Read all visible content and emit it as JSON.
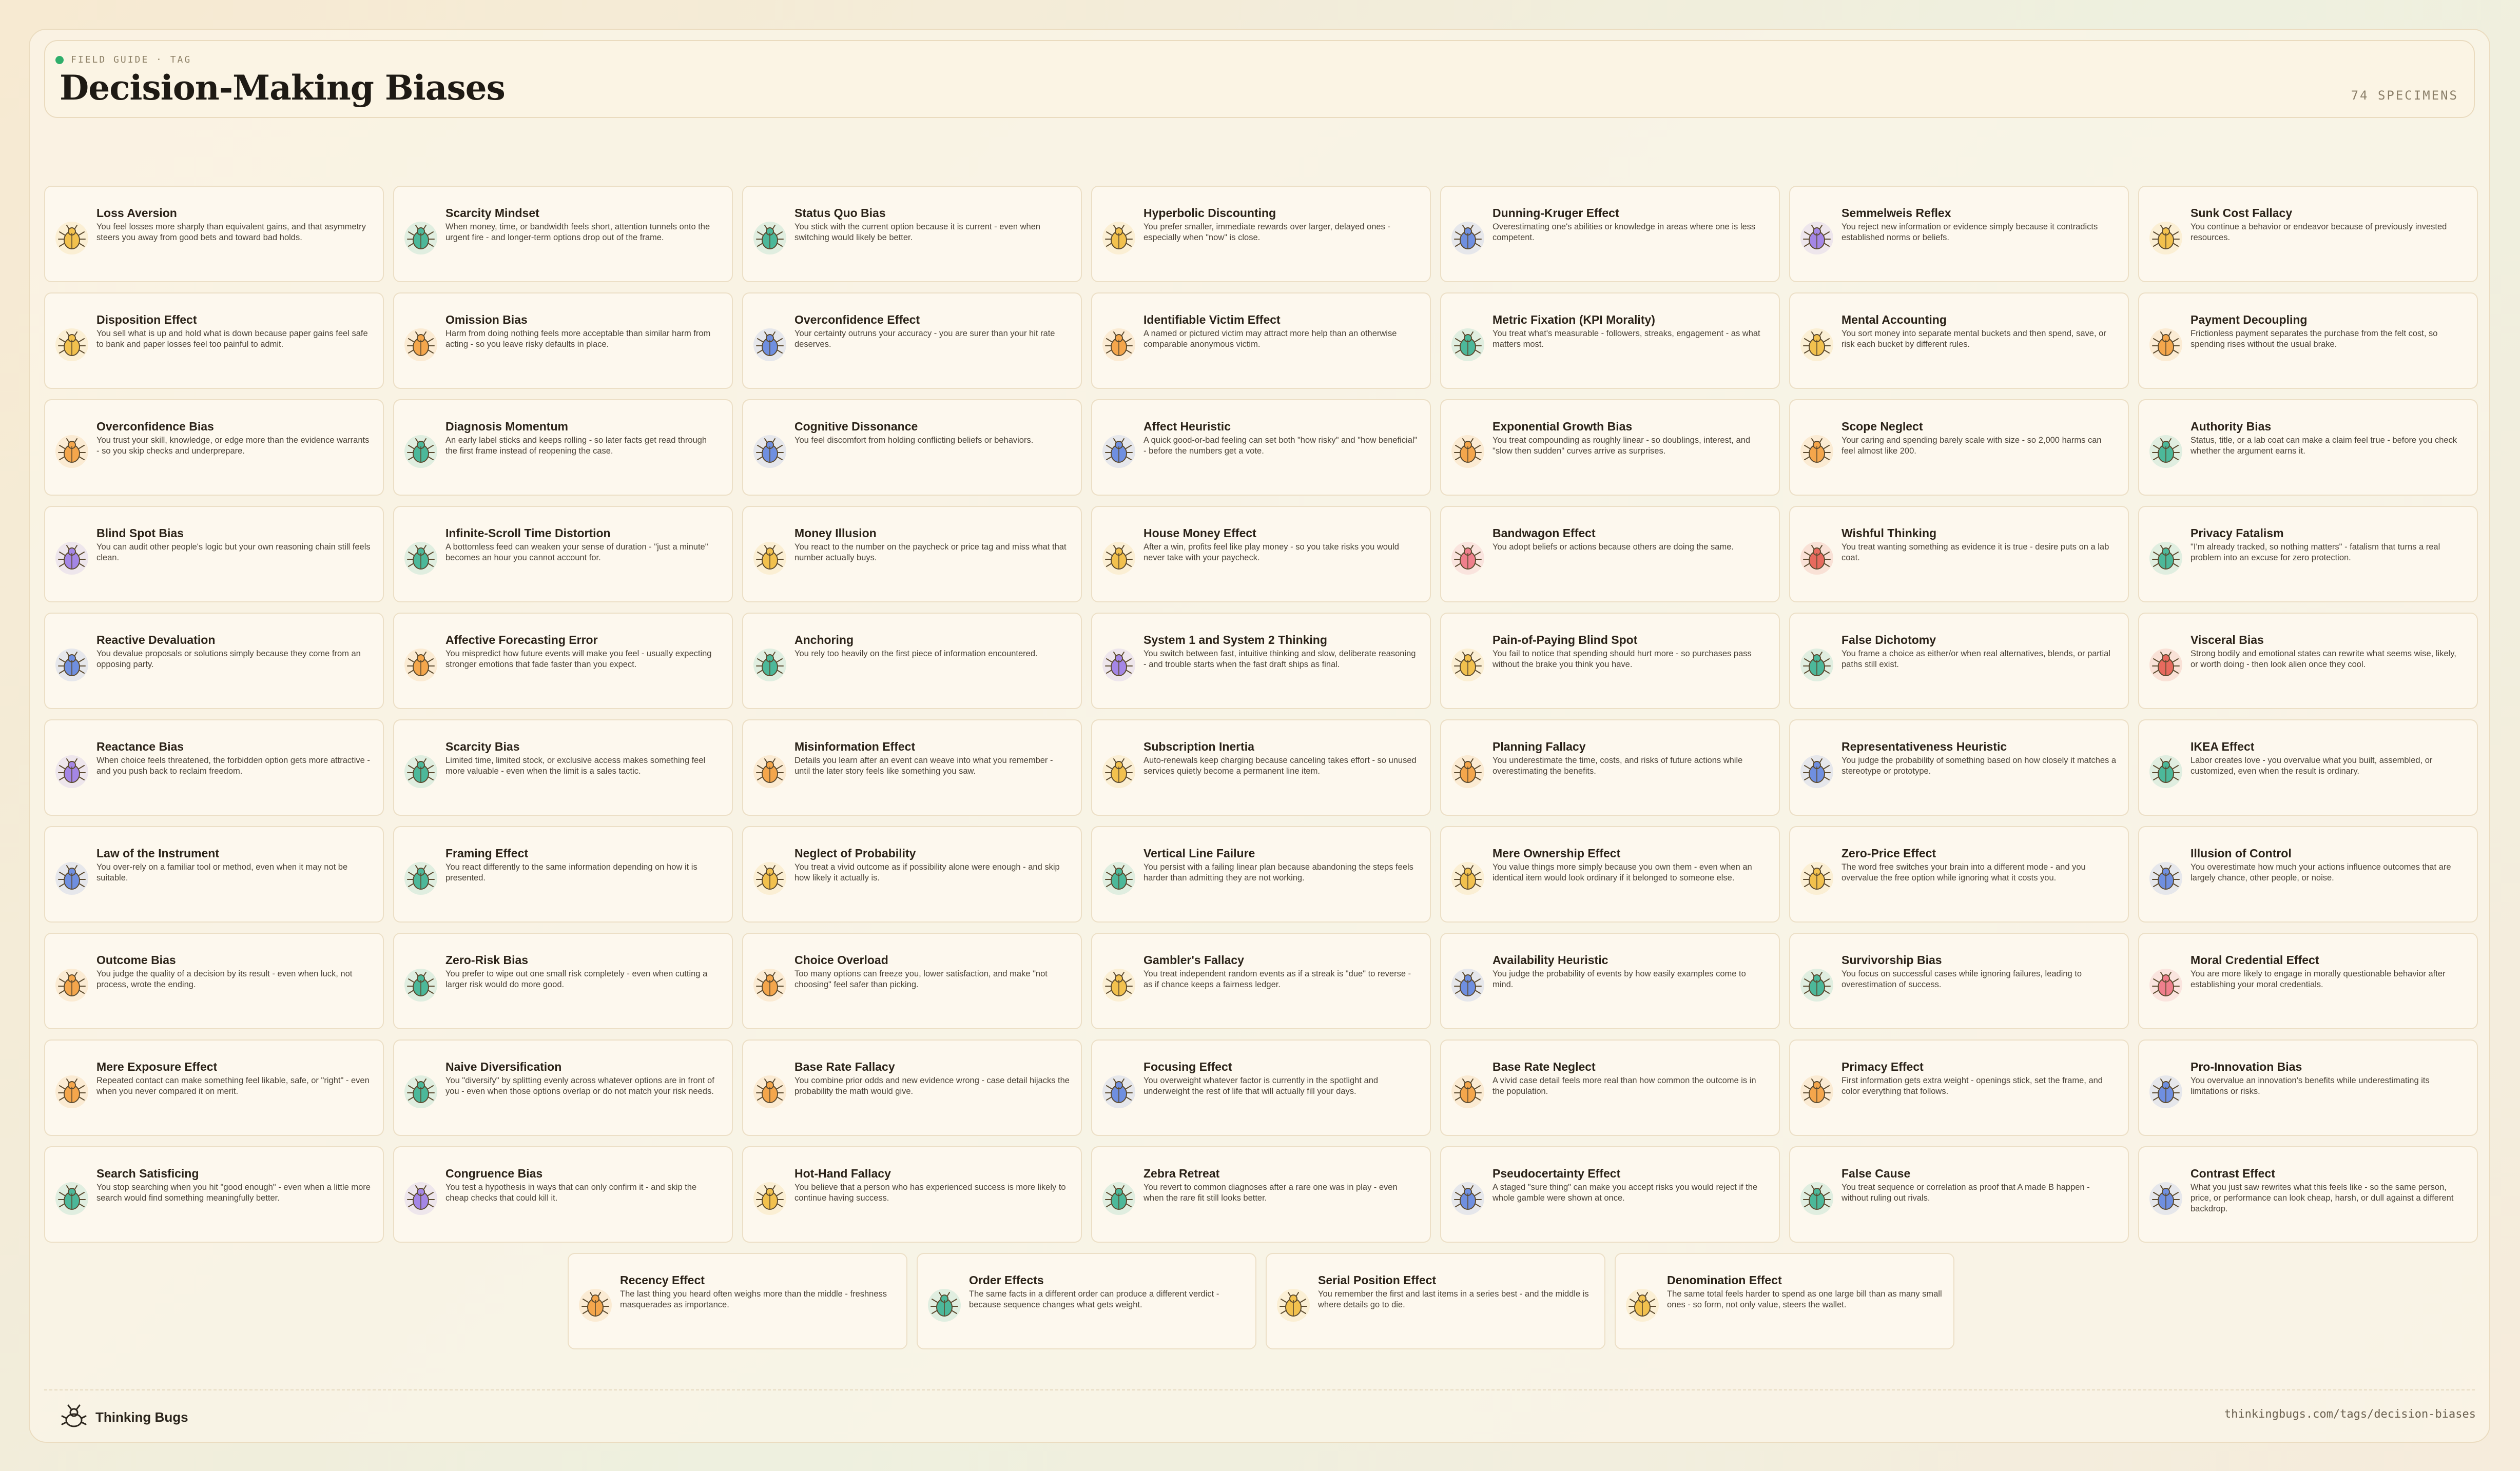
{
  "header": {
    "eyebrow": "FIELD GUIDE · TAG",
    "title": "Decision-Making Biases",
    "count": "74 SPECIMENS"
  },
  "footer": {
    "brand": "Thinking Bugs",
    "url": "thinkingbugs.com/tags/decision-biases"
  },
  "bug_colors": {
    "yellow": "#f2c14e",
    "orange": "#f4a64c",
    "teal": "#4cb89a",
    "blue": "#6f8fe0",
    "purple": "#a486e6",
    "pink": "#ef7f8c",
    "red": "#e76a5e"
  },
  "cards": [
    {
      "name": "Loss Aversion",
      "desc": "You feel losses more sharply than equivalent gains, and that asymmetry steers you away from good bets and toward bad holds.",
      "color": "yellow"
    },
    {
      "name": "Scarcity Mindset",
      "desc": "When money, time, or bandwidth feels short, attention tunnels onto the urgent fire - and longer-term options drop out of the frame.",
      "color": "teal"
    },
    {
      "name": "Status Quo Bias",
      "desc": "You stick with the current option because it is current - even when switching would likely be better.",
      "color": "teal"
    },
    {
      "name": "Hyperbolic Discounting",
      "desc": "You prefer smaller, immediate rewards over larger, delayed ones - especially when \"now\" is close.",
      "color": "yellow"
    },
    {
      "name": "Dunning-Kruger Effect",
      "desc": "Overestimating one's abilities or knowledge in areas where one is less competent.",
      "color": "blue"
    },
    {
      "name": "Semmelweis Reflex",
      "desc": "You reject new information or evidence simply because it contradicts established norms or beliefs.",
      "color": "purple"
    },
    {
      "name": "Sunk Cost Fallacy",
      "desc": "You continue a behavior or endeavor because of previously invested resources.",
      "color": "yellow"
    },
    {
      "name": "Disposition Effect",
      "desc": "You sell what is up and hold what is down because paper gains feel safe to bank and paper losses feel too painful to admit.",
      "color": "yellow"
    },
    {
      "name": "Omission Bias",
      "desc": "Harm from doing nothing feels more acceptable than similar harm from acting - so you leave risky defaults in place.",
      "color": "orange"
    },
    {
      "name": "Overconfidence Effect",
      "desc": "Your certainty outruns your accuracy - you are surer than your hit rate deserves.",
      "color": "blue"
    },
    {
      "name": "Identifiable Victim Effect",
      "desc": "A named or pictured victim may attract more help than an otherwise comparable anonymous victim.",
      "color": "orange"
    },
    {
      "name": "Metric Fixation (KPI Morality)",
      "desc": "You treat what's measurable - followers, streaks, engagement - as what matters most.",
      "color": "teal"
    },
    {
      "name": "Mental Accounting",
      "desc": "You sort money into separate mental buckets and then spend, save, or risk each bucket by different rules.",
      "color": "yellow"
    },
    {
      "name": "Payment Decoupling",
      "desc": "Frictionless payment separates the purchase from the felt cost, so spending rises without the usual brake.",
      "color": "orange"
    },
    {
      "name": "Overconfidence Bias",
      "desc": "You trust your skill, knowledge, or edge more than the evidence warrants - so you skip checks and underprepare.",
      "color": "orange"
    },
    {
      "name": "Diagnosis Momentum",
      "desc": "An early label sticks and keeps rolling - so later facts get read through the first frame instead of reopening the case.",
      "color": "teal"
    },
    {
      "name": "Cognitive Dissonance",
      "desc": "You feel discomfort from holding conflicting beliefs or behaviors.",
      "color": "blue"
    },
    {
      "name": "Affect Heuristic",
      "desc": "A quick good-or-bad feeling can set both \"how risky\" and \"how beneficial\" - before the numbers get a vote.",
      "color": "blue"
    },
    {
      "name": "Exponential Growth Bias",
      "desc": "You treat compounding as roughly linear - so doublings, interest, and \"slow then sudden\" curves arrive as surprises.",
      "color": "orange"
    },
    {
      "name": "Scope Neglect",
      "desc": "Your caring and spending barely scale with size - so 2,000 harms can feel almost like 200.",
      "color": "orange"
    },
    {
      "name": "Authority Bias",
      "desc": "Status, title, or a lab coat can make a claim feel true - before you check whether the argument earns it.",
      "color": "teal"
    },
    {
      "name": "Blind Spot Bias",
      "desc": "You can audit other people's logic but your own reasoning chain still feels clean.",
      "color": "purple"
    },
    {
      "name": "Infinite-Scroll Time Distortion",
      "desc": "A bottomless feed can weaken your sense of duration - \"just a minute\" becomes an hour you cannot account for.",
      "color": "teal"
    },
    {
      "name": "Money Illusion",
      "desc": "You react to the number on the paycheck or price tag and miss what that number actually buys.",
      "color": "yellow"
    },
    {
      "name": "House Money Effect",
      "desc": "After a win, profits feel like play money - so you take risks you would never take with your paycheck.",
      "color": "yellow"
    },
    {
      "name": "Bandwagon Effect",
      "desc": "You adopt beliefs or actions because others are doing the same.",
      "color": "pink"
    },
    {
      "name": "Wishful Thinking",
      "desc": "You treat wanting something as evidence it is true - desire puts on a lab coat.",
      "color": "red"
    },
    {
      "name": "Privacy Fatalism",
      "desc": "\"I'm already tracked, so nothing matters\" - fatalism that turns a real problem into an excuse for zero protection.",
      "color": "teal"
    },
    {
      "name": "Reactive Devaluation",
      "desc": "You devalue proposals or solutions simply because they come from an opposing party.",
      "color": "blue"
    },
    {
      "name": "Affective Forecasting Error",
      "desc": "You mispredict how future events will make you feel - usually expecting stronger emotions that fade faster than you expect.",
      "color": "orange"
    },
    {
      "name": "Anchoring",
      "desc": "You rely too heavily on the first piece of information encountered.",
      "color": "teal"
    },
    {
      "name": "System 1 and System 2 Thinking",
      "desc": "You switch between fast, intuitive thinking and slow, deliberate reasoning - and trouble starts when the fast draft ships as final.",
      "color": "purple"
    },
    {
      "name": "Pain-of-Paying Blind Spot",
      "desc": "You fail to notice that spending should hurt more - so purchases pass without the brake you think you have.",
      "color": "yellow"
    },
    {
      "name": "False Dichotomy",
      "desc": "You frame a choice as either/or when real alternatives, blends, or partial paths still exist.",
      "color": "teal"
    },
    {
      "name": "Visceral Bias",
      "desc": "Strong bodily and emotional states can rewrite what seems wise, likely, or worth doing - then look alien once they cool.",
      "color": "red"
    },
    {
      "name": "Reactance Bias",
      "desc": "When choice feels threatened, the forbidden option gets more attractive - and you push back to reclaim freedom.",
      "color": "purple"
    },
    {
      "name": "Scarcity Bias",
      "desc": "Limited time, limited stock, or exclusive access makes something feel more valuable - even when the limit is a sales tactic.",
      "color": "teal"
    },
    {
      "name": "Misinformation Effect",
      "desc": "Details you learn after an event can weave into what you remember - until the later story feels like something you saw.",
      "color": "orange"
    },
    {
      "name": "Subscription Inertia",
      "desc": "Auto-renewals keep charging because canceling takes effort - so unused services quietly become a permanent line item.",
      "color": "yellow"
    },
    {
      "name": "Planning Fallacy",
      "desc": "You underestimate the time, costs, and risks of future actions while overestimating the benefits.",
      "color": "orange"
    },
    {
      "name": "Representativeness Heuristic",
      "desc": "You judge the probability of something based on how closely it matches a stereotype or prototype.",
      "color": "blue"
    },
    {
      "name": "IKEA Effect",
      "desc": "Labor creates love - you overvalue what you built, assembled, or customized, even when the result is ordinary.",
      "color": "teal"
    },
    {
      "name": "Law of the Instrument",
      "desc": "You over-rely on a familiar tool or method, even when it may not be suitable.",
      "color": "blue"
    },
    {
      "name": "Framing Effect",
      "desc": "You react differently to the same information depending on how it is presented.",
      "color": "teal"
    },
    {
      "name": "Neglect of Probability",
      "desc": "You treat a vivid outcome as if possibility alone were enough - and skip how likely it actually is.",
      "color": "yellow"
    },
    {
      "name": "Vertical Line Failure",
      "desc": "You persist with a failing linear plan because abandoning the steps feels harder than admitting they are not working.",
      "color": "teal"
    },
    {
      "name": "Mere Ownership Effect",
      "desc": "You value things more simply because you own them - even when an identical item would look ordinary if it belonged to someone else.",
      "color": "yellow"
    },
    {
      "name": "Zero-Price Effect",
      "desc": "The word free switches your brain into a different mode - and you overvalue the free option while ignoring what it costs you.",
      "color": "yellow"
    },
    {
      "name": "Illusion of Control",
      "desc": "You overestimate how much your actions influence outcomes that are largely chance, other people, or noise.",
      "color": "blue"
    },
    {
      "name": "Outcome Bias",
      "desc": "You judge the quality of a decision by its result - even when luck, not process, wrote the ending.",
      "color": "orange"
    },
    {
      "name": "Zero-Risk Bias",
      "desc": "You prefer to wipe out one small risk completely - even when cutting a larger risk would do more good.",
      "color": "teal"
    },
    {
      "name": "Choice Overload",
      "desc": "Too many options can freeze you, lower satisfaction, and make \"not choosing\" feel safer than picking.",
      "color": "orange"
    },
    {
      "name": "Gambler's Fallacy",
      "desc": "You treat independent random events as if a streak is \"due\" to reverse - as if chance keeps a fairness ledger.",
      "color": "yellow"
    },
    {
      "name": "Availability Heuristic",
      "desc": "You judge the probability of events by how easily examples come to mind.",
      "color": "blue"
    },
    {
      "name": "Survivorship Bias",
      "desc": "You focus on successful cases while ignoring failures, leading to overestimation of success.",
      "color": "teal"
    },
    {
      "name": "Moral Credential Effect",
      "desc": "You are more likely to engage in morally questionable behavior after establishing your moral credentials.",
      "color": "pink"
    },
    {
      "name": "Mere Exposure Effect",
      "desc": "Repeated contact can make something feel likable, safe, or \"right\" - even when you never compared it on merit.",
      "color": "orange"
    },
    {
      "name": "Naive Diversification",
      "desc": "You \"diversify\" by splitting evenly across whatever options are in front of you - even when those options overlap or do not match your risk needs.",
      "color": "teal"
    },
    {
      "name": "Base Rate Fallacy",
      "desc": "You combine prior odds and new evidence wrong - case detail hijacks the probability the math would give.",
      "color": "orange"
    },
    {
      "name": "Focusing Effect",
      "desc": "You overweight whatever factor is currently in the spotlight and underweight the rest of life that will actually fill your days.",
      "color": "blue"
    },
    {
      "name": "Base Rate Neglect",
      "desc": "A vivid case detail feels more real than how common the outcome is in the population.",
      "color": "orange"
    },
    {
      "name": "Primacy Effect",
      "desc": "First information gets extra weight - openings stick, set the frame, and color everything that follows.",
      "color": "orange"
    },
    {
      "name": "Pro-Innovation Bias",
      "desc": "You overvalue an innovation's benefits while underestimating its limitations or risks.",
      "color": "blue"
    },
    {
      "name": "Search Satisficing",
      "desc": "You stop searching when you hit \"good enough\" - even when a little more search would find something meaningfully better.",
      "color": "teal"
    },
    {
      "name": "Congruence Bias",
      "desc": "You test a hypothesis in ways that can only confirm it - and skip the cheap checks that could kill it.",
      "color": "purple"
    },
    {
      "name": "Hot-Hand Fallacy",
      "desc": "You believe that a person who has experienced success is more likely to continue having success.",
      "color": "yellow"
    },
    {
      "name": "Zebra Retreat",
      "desc": "You revert to common diagnoses after a rare one was in play - even when the rare fit still looks better.",
      "color": "teal"
    },
    {
      "name": "Pseudocertainty Effect",
      "desc": "A staged \"sure thing\" can make you accept risks you would reject if the whole gamble were shown at once.",
      "color": "blue"
    },
    {
      "name": "False Cause",
      "desc": "You treat sequence or correlation as proof that A made B happen - without ruling out rivals.",
      "color": "teal"
    },
    {
      "name": "Contrast Effect",
      "desc": "What you just saw rewrites what this feels like - so the same person, price, or performance can look cheap, harsh, or dull against a different backdrop.",
      "color": "blue"
    },
    {
      "name": "Recency Effect",
      "desc": "The last thing you heard often weighs more than the middle - freshness masquerades as importance.",
      "color": "orange"
    },
    {
      "name": "Order Effects",
      "desc": "The same facts in a different order can produce a different verdict - because sequence changes what gets weight.",
      "color": "teal"
    },
    {
      "name": "Serial Position Effect",
      "desc": "You remember the first and last items in a series best - and the middle is where details go to die.",
      "color": "yellow"
    },
    {
      "name": "Denomination Effect",
      "desc": "The same total feels harder to spend as one large bill than as many small ones - so form, not only value, steers the wallet.",
      "color": "yellow"
    }
  ]
}
